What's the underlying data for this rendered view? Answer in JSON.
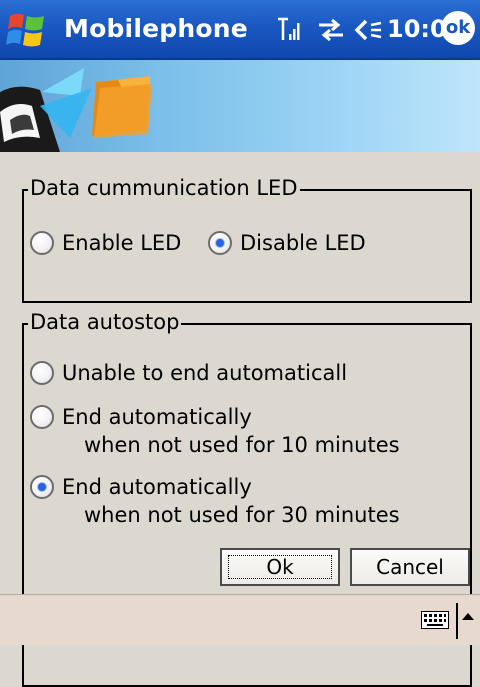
{
  "titlebar": {
    "start_icon": "windows-flag-icon",
    "title": "Mobilephone",
    "signal_icon": "signal-strength-icon",
    "sync_icon": "connectivity-arrows-icon",
    "volume_icon": "speaker-volume-icon",
    "time": "10:01",
    "ok_label": "ok"
  },
  "banner": {
    "icon": "phone-folder-transfer-icon"
  },
  "led_group": {
    "legend": "Data cummunication LED",
    "options": [
      {
        "label": "Enable LED",
        "checked": false
      },
      {
        "label": "Disable LED",
        "checked": true
      }
    ]
  },
  "autostop_group": {
    "legend": "Data autostop",
    "options": [
      {
        "label": "Unable to end automaticall",
        "label2": "",
        "checked": false
      },
      {
        "label": "End automatically",
        "label2": "when not used for 10 minutes",
        "checked": false
      },
      {
        "label": "End automatically",
        "label2": "when not used for 30 minutes",
        "checked": true
      }
    ]
  },
  "buttons": {
    "ok": "Ok",
    "cancel": "Cancel"
  },
  "bottombar": {
    "keyboard_icon": "keyboard-icon",
    "arrow_icon": "up-arrow-icon"
  },
  "colors": {
    "title_bar": "#1a58c2",
    "background": "#dcd8d0",
    "bottom_bar": "#e7d9cf"
  }
}
